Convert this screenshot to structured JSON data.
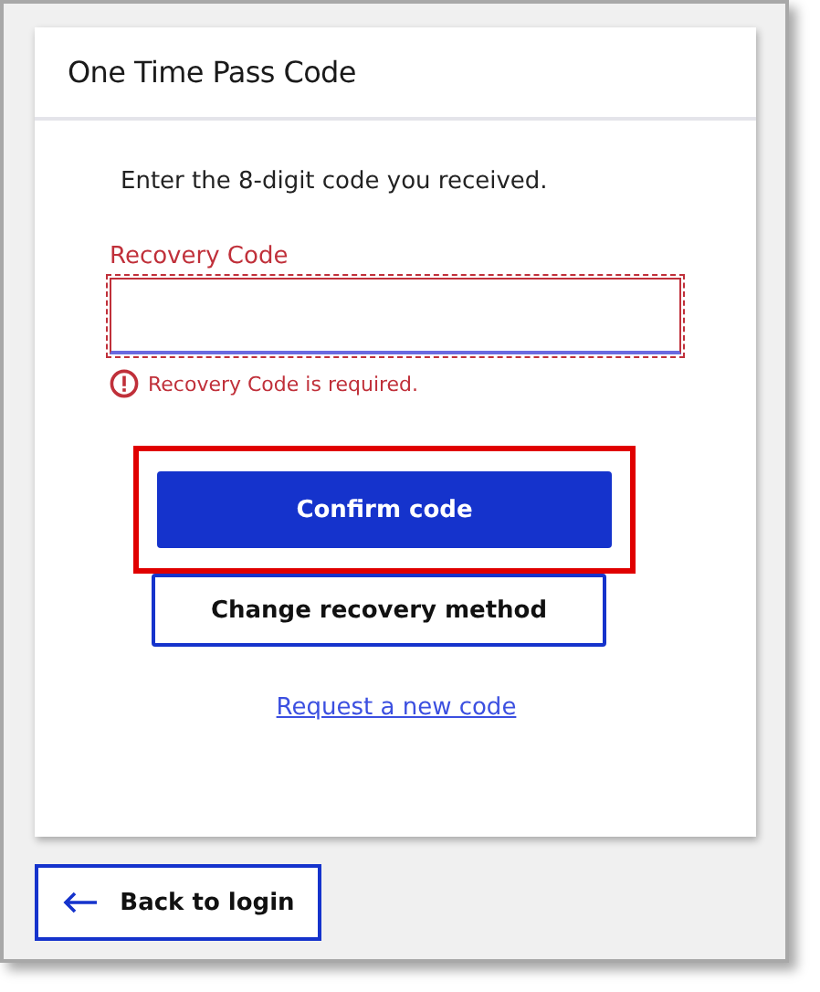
{
  "card": {
    "title": "One Time Pass Code",
    "instruction": "Enter the 8-digit code you received.",
    "field": {
      "label": "Recovery Code",
      "error": true,
      "error_message": "Recovery Code is required."
    },
    "buttons": [
      {
        "label": "Confirm code",
        "kind": "primary",
        "highlighted": true
      },
      {
        "label": "Change recovery method",
        "kind": "secondary",
        "highlighted": false
      }
    ],
    "link": "Request a new code"
  },
  "back_button": {
    "label": "Back to login"
  }
}
